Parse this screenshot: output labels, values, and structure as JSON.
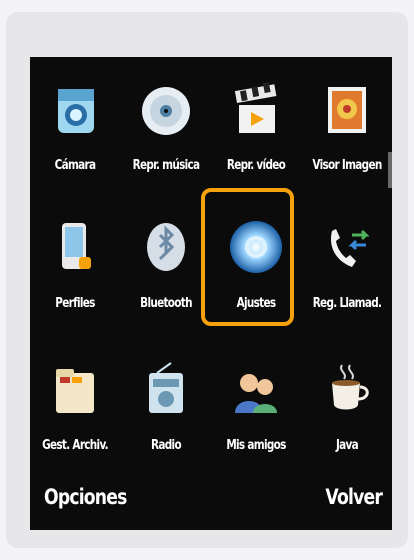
{
  "apps": [
    {
      "id": "camara",
      "label": "Cámara",
      "icon": "camera-icon"
    },
    {
      "id": "repr-musica",
      "label": "Repr. música",
      "icon": "music-disc-icon"
    },
    {
      "id": "repr-video",
      "label": "Repr. vídeo",
      "icon": "clapperboard-icon"
    },
    {
      "id": "visor-imagen",
      "label": "Visor Imagen",
      "icon": "picture-icon"
    },
    {
      "id": "perfiles",
      "label": "Perfiles",
      "icon": "phone-profile-icon"
    },
    {
      "id": "bluetooth",
      "label": "Bluetooth",
      "icon": "bluetooth-icon"
    },
    {
      "id": "ajustes",
      "label": "Ajustes",
      "icon": "settings-gear-icon"
    },
    {
      "id": "reg-llamadas",
      "label": "Reg. Llamad.",
      "icon": "call-log-icon"
    },
    {
      "id": "gest-archiv",
      "label": "Gest. Archiv.",
      "icon": "folder-icon"
    },
    {
      "id": "radio",
      "label": "Radio",
      "icon": "radio-icon"
    },
    {
      "id": "mis-amigos",
      "label": "Mis amigos",
      "icon": "friends-icon"
    },
    {
      "id": "java",
      "label": "Java",
      "icon": "java-cup-icon"
    }
  ],
  "selected": "Ajustes",
  "softkeys": {
    "left": "Opciones",
    "right": "Volver"
  },
  "colors": {
    "highlight": "#f5a20d",
    "background": "#0b0b0b"
  }
}
